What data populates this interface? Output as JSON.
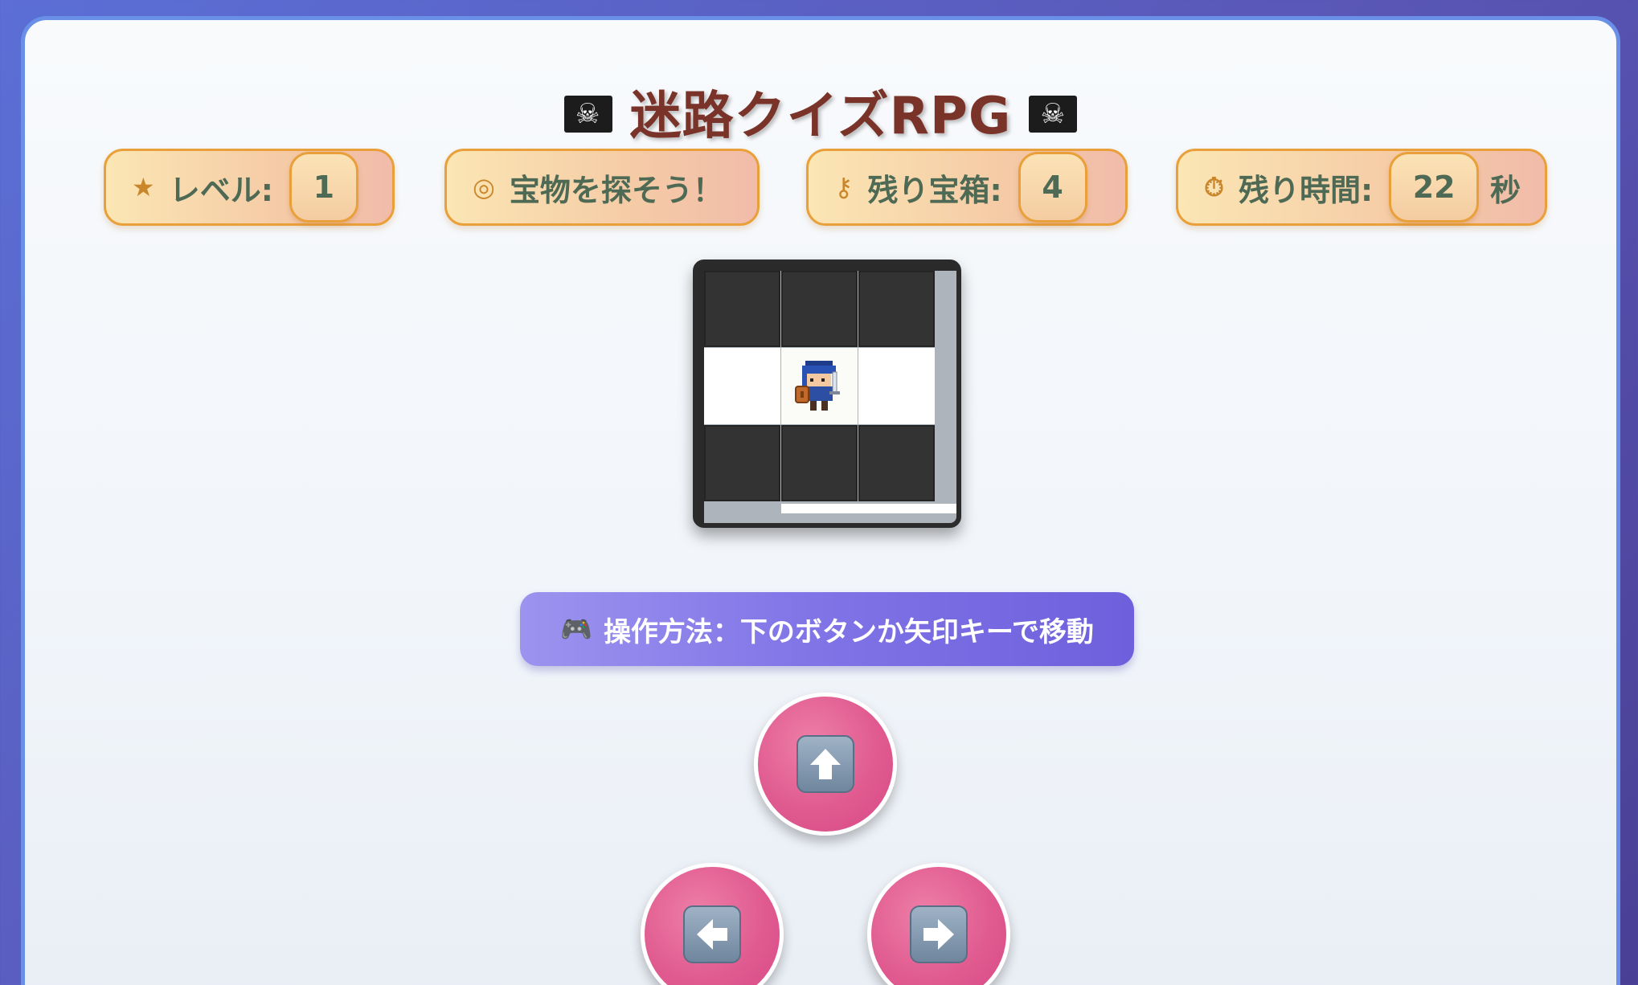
{
  "title": {
    "text": "迷路クイズRPG",
    "left_icon": "pirate-flag-icon",
    "right_icon": "pirate-flag-icon"
  },
  "status": {
    "level": {
      "icon": "star-icon",
      "label": "レベル:",
      "value": "1"
    },
    "objective": {
      "icon": "target-icon",
      "label": "宝物を探そう！"
    },
    "chests": {
      "icon": "key-icon",
      "label": "残り宝箱:",
      "value": "4"
    },
    "timer": {
      "icon": "stopwatch-icon",
      "label": "残り時間:",
      "value": "22",
      "unit": "秒"
    }
  },
  "maze": {
    "rows": [
      [
        "wall",
        "wall",
        "wall"
      ],
      [
        "path",
        "hero",
        "path"
      ],
      [
        "wall",
        "wall",
        "wall"
      ]
    ]
  },
  "help": {
    "icon": "gamepad-icon",
    "text": "操作方法：下のボタンか矢印キーで移動"
  },
  "controls": {
    "up_icon": "up-arrow-icon",
    "left_icon": "left-arrow-icon",
    "right_icon": "right-arrow-icon"
  },
  "colors": {
    "title": "#7a3328",
    "pill_border": "#e9a03a",
    "pill_text": "#4e6a54",
    "button": "#e05b90",
    "help_bg": "#7f73e6"
  }
}
